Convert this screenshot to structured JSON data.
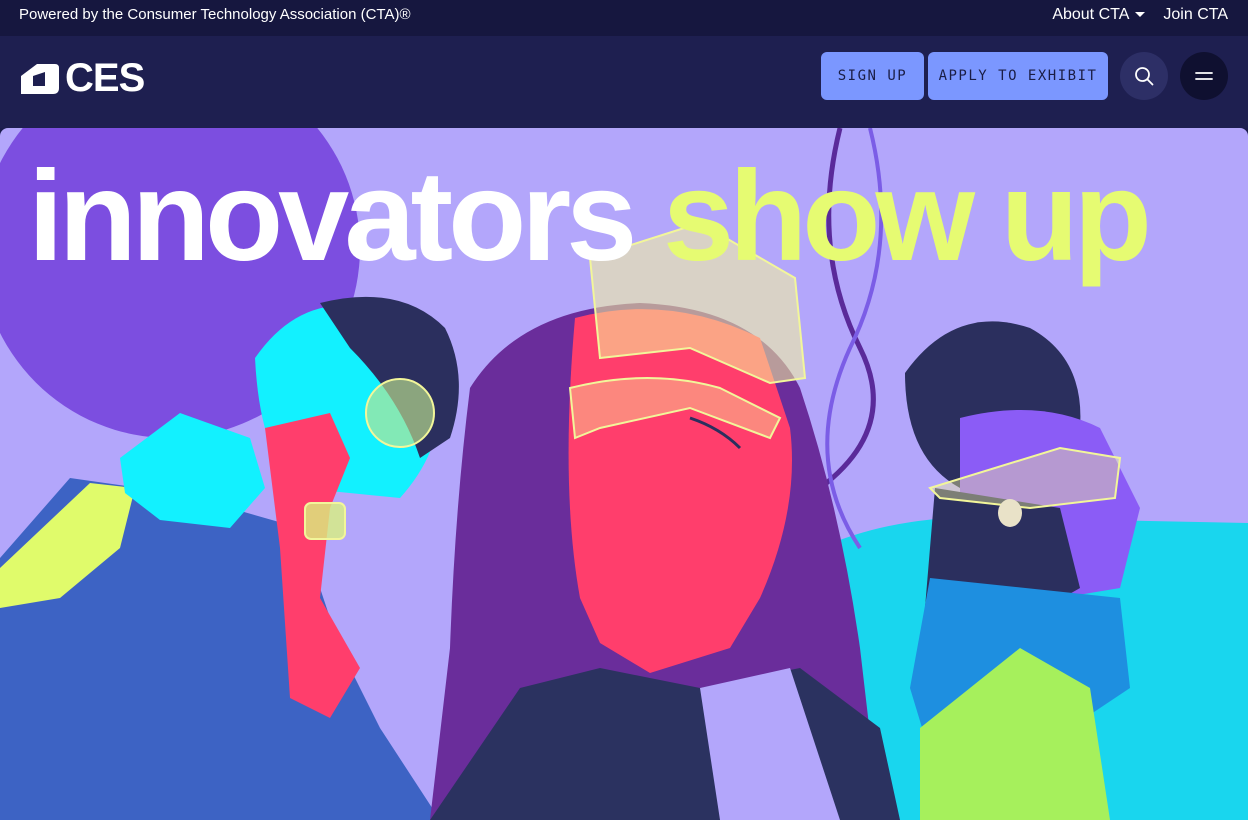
{
  "topbar": {
    "powered_text": "Powered by the Consumer Technology Association (CTA)®",
    "about_label": "About CTA",
    "join_label": "Join CTA"
  },
  "header": {
    "logo_text": "CES",
    "signup_label": "SIGN UP",
    "apply_label": "APPLY TO EXHIBIT"
  },
  "hero": {
    "headline_white": "innovators",
    "headline_yellow": "show up"
  },
  "colors": {
    "topbar_bg": "#16173f",
    "header_bg": "#1e1f50",
    "button_bg": "#7b97ff",
    "hero_bg": "#b3a6fb",
    "headline_accent": "#e6fb72"
  },
  "icons": [
    "ces-logo-icon",
    "caret-down-icon",
    "search-icon",
    "menu-icon"
  ]
}
